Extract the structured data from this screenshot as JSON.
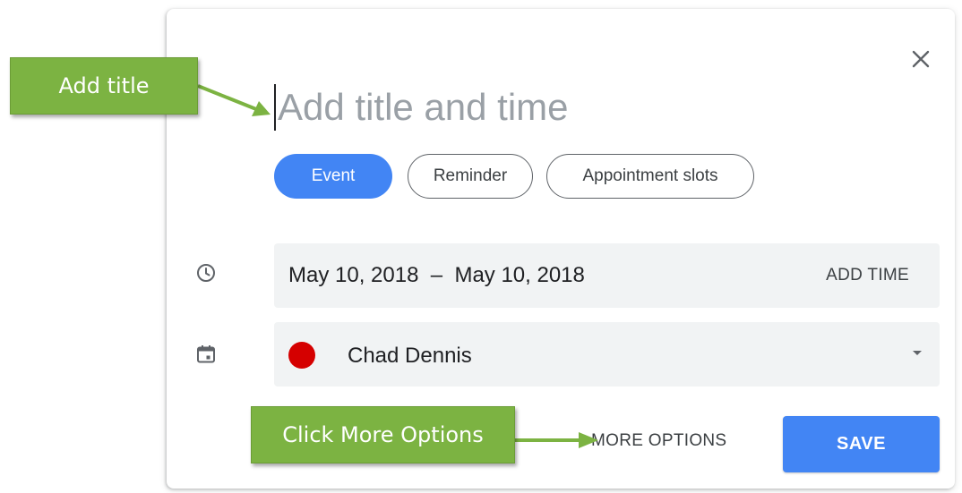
{
  "dialog": {
    "title_placeholder": "Add title and time",
    "close_icon": "close-icon"
  },
  "chips": {
    "event": "Event",
    "reminder": "Reminder",
    "appointment_slots": "Appointment slots",
    "selected": "Event"
  },
  "date_row": {
    "icon": "clock-icon",
    "range": "May 10, 2018  –  May 10, 2018",
    "add_time": "ADD TIME"
  },
  "calendar_row": {
    "icon": "calendar-icon",
    "name": "Chad Dennis",
    "color": "#d50000"
  },
  "footer": {
    "more_options": "MORE OPTIONS",
    "save": "SAVE"
  },
  "annotations": {
    "add_title": "Add title",
    "click_more_options": "Click More Options",
    "color": "#7cb342"
  },
  "colors": {
    "primary": "#4285f4",
    "field_bg": "#f1f3f4"
  }
}
